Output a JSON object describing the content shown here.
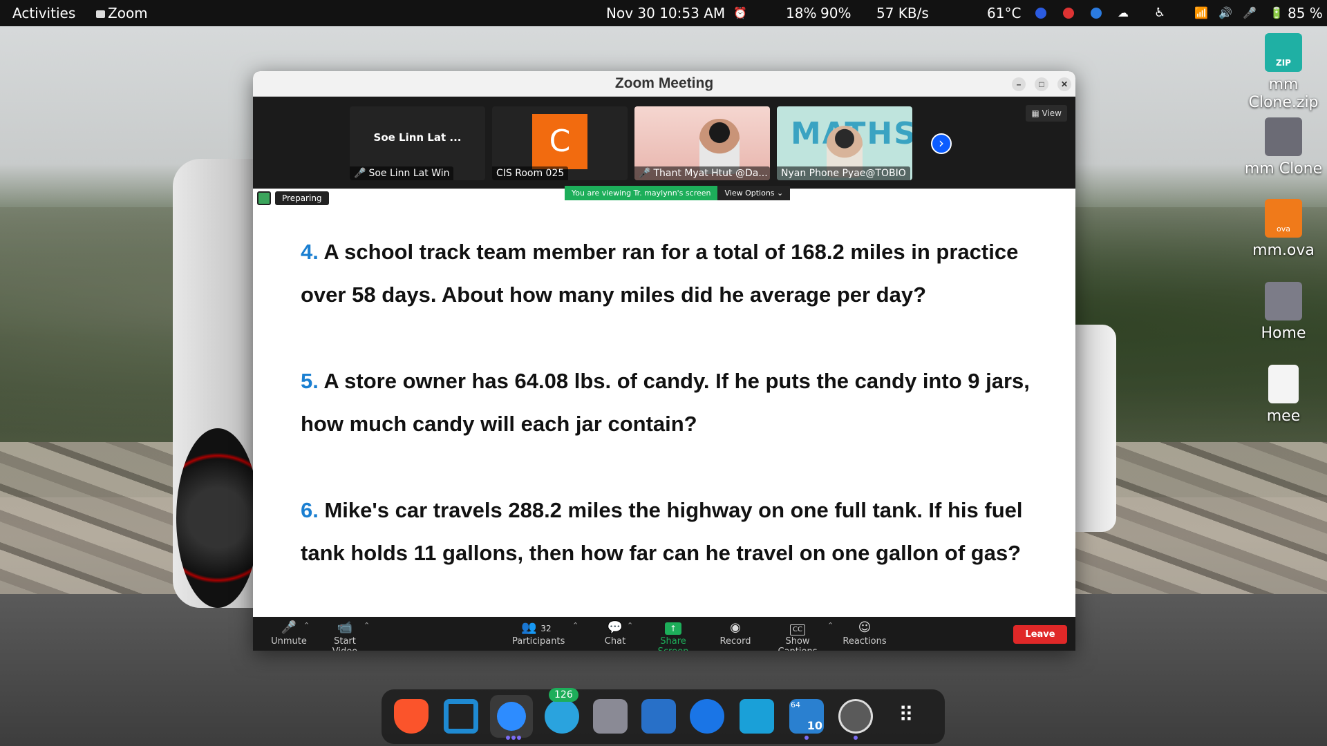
{
  "topbar": {
    "activities": "Activities",
    "app_name": "Zoom",
    "datetime": "Nov 30  10:53 AM",
    "cpu": "18%",
    "mem": "90%",
    "net": "57 KB/s",
    "temp": "61°C",
    "battery": "85 %"
  },
  "desktop": {
    "icons": [
      {
        "label": "mm\nClone.zip",
        "icon": "zip-icon"
      },
      {
        "label": "mm Clone",
        "icon": "folder-icon"
      },
      {
        "label": "mm.ova",
        "icon": "ova-icon"
      },
      {
        "label": "Home",
        "icon": "home-folder-icon"
      },
      {
        "label": "mee",
        "icon": "document-icon"
      }
    ],
    "zip_badge": "ZIP",
    "ova_badge": "ova"
  },
  "zoom": {
    "title": "Zoom Meeting",
    "view_label": "View",
    "participants": [
      {
        "title": "Soe Linn Lat ...",
        "name": "Soe Linn Lat Win",
        "muted": true
      },
      {
        "avatar_letter": "C",
        "name": "CIS Room 025",
        "muted": false
      },
      {
        "name": "Thant Myat Htut @Da...",
        "muted": true
      },
      {
        "name": "Nyan Phone Pyae@TOBIO",
        "muted": false
      }
    ],
    "preparing": "Preparing",
    "viewing_banner": "You are viewing Tr. maylynn's screen",
    "view_options": "View Options",
    "maths_text": "MATHS",
    "questions": [
      {
        "num": "4.",
        "text": " A school track team member ran for a total of 168.2 miles in practice over 58 days. About how many miles did he average per day?"
      },
      {
        "num": "5.",
        "text": " A store owner has 64.08 lbs. of candy. If he puts the candy into 9 jars, how much candy will each jar contain?"
      },
      {
        "num": "6.",
        "text": " Mike's car travels 288.2 miles the highway on one full tank. If his fuel tank holds 11 gallons, then how far can he travel on one gallon of gas?"
      }
    ],
    "toolbar": {
      "unmute": "Unmute",
      "start_video": "Start Video",
      "participants": "Participants",
      "participants_count": "32",
      "chat": "Chat",
      "share_screen": "Share Screen",
      "record": "Record",
      "show_captions": "Show Captions",
      "reactions": "Reactions",
      "leave": "Leave"
    }
  },
  "dock": {
    "telegram_badge": "126",
    "app_badge_64": "64",
    "app_badge_10": "10"
  }
}
